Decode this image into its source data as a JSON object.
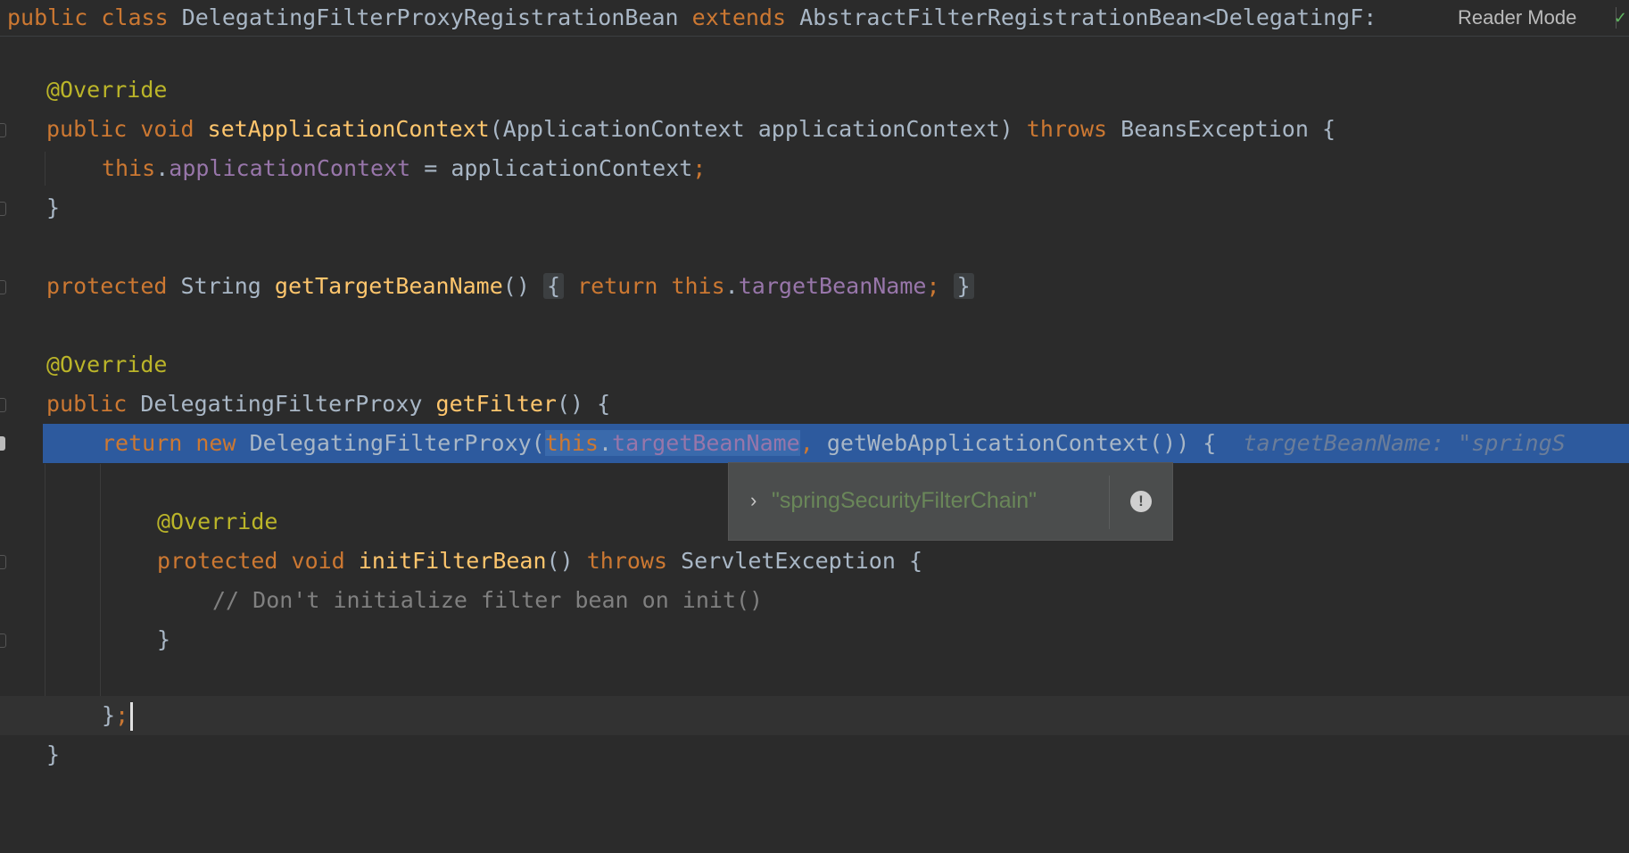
{
  "header": {
    "t1": "public",
    "t2": "class",
    "t3": "DelegatingFilterProxyRegistrationBean",
    "t4": "extends",
    "t5": "AbstractFilterRegistrationBean<DelegatingF:"
  },
  "reader_mode": "Reader Mode",
  "code": {
    "override": "@Override",
    "kw_public": "public",
    "kw_void": "void",
    "kw_protected": "protected",
    "kw_throws": "throws",
    "kw_this": "this",
    "kw_return": "return",
    "kw_new": "new",
    "set_name": "setApplicationContext",
    "set_params": "(ApplicationContext applicationContext)",
    "beans_exc": "BeansException {",
    "this_dot": ".",
    "field_appctx": "applicationContext",
    "assign": " = applicationContext",
    "semicolon": ";",
    "close_brace": "}",
    "string_type": "String",
    "get_target": "getTargetBeanName",
    "parens": "()",
    "open_brace": "{",
    "field_target": "targetBeanName",
    "dfp_type": "DelegatingFilterProxy",
    "get_filter": "getFilter",
    "parens_brace": "() {",
    "dfp_call": "DelegatingFilterProxy(",
    "comma": ",",
    "get_wac": "getWebApplicationContext()) {",
    "hint": "targetBeanName: \"springS",
    "init_name": "initFilterBean",
    "servlet_exc": "ServletException {",
    "comment": "// Don't initialize filter bean on init()",
    "close_semi": "};"
  },
  "popup": {
    "value": "\"springSecurityFilterChain\""
  }
}
